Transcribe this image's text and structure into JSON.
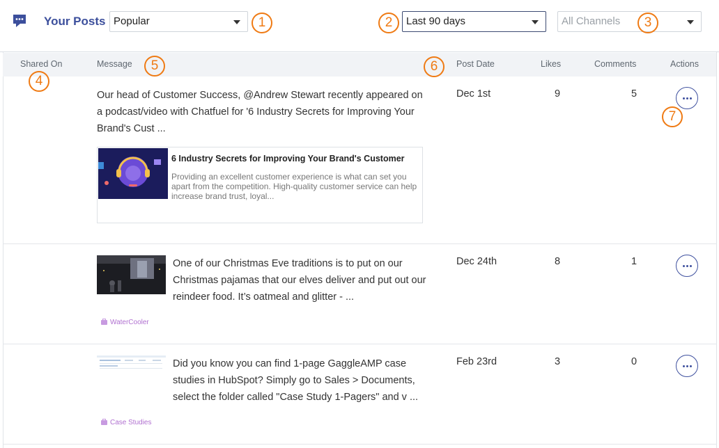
{
  "header": {
    "title": "Your Posts",
    "sort_select": {
      "value": "Popular"
    },
    "date_range_select": {
      "value": "Last 90 days"
    },
    "channels_select": {
      "placeholder": "All Channels"
    }
  },
  "table": {
    "columns": {
      "shared_on": "Shared On",
      "message": "Message",
      "post_date": "Post Date",
      "likes": "Likes",
      "comments": "Comments",
      "actions": "Actions"
    },
    "rows": [
      {
        "message": "Our head of Customer Success, @Andrew Stewart recently appeared on a podcast/video with Chatfuel for '6 Industry Secrets for Improving Your Brand's Cust ...",
        "link_card": {
          "title": "6 Industry Secrets for Improving Your Brand's Customer",
          "description": "Providing an excellent customer experience is what can set you apart from the competition. High-quality customer service can help increase brand trust, loyal..."
        },
        "post_date": "Dec 1st",
        "likes": "9",
        "comments": "5"
      },
      {
        "message": "One of our Christmas Eve traditions is to put on our Christmas pajamas that our elves deliver and put out our reindeer food. It’s oatmeal and glitter - ...",
        "tag": "WaterCooler",
        "post_date": "Dec 24th",
        "likes": "8",
        "comments": "1"
      },
      {
        "message": "Did you know you can find 1-page GaggleAMP case studies in HubSpot? Simply go to Sales > Documents, select the folder called \"Case Study 1-Pagers\" and v ...",
        "tag": "Case Studies",
        "post_date": "Feb 23rd",
        "likes": "3",
        "comments": "0"
      }
    ]
  },
  "callouts": [
    "1",
    "2",
    "3",
    "4",
    "5",
    "6",
    "7"
  ],
  "icons": [
    "chat-icon",
    "caret-down-icon",
    "more-icon",
    "tag-icon"
  ],
  "colors": {
    "brand": "#3c4f9c",
    "callout": "#ef7a13",
    "tag": "#b070d0",
    "header_bg": "#f1f3f6"
  }
}
